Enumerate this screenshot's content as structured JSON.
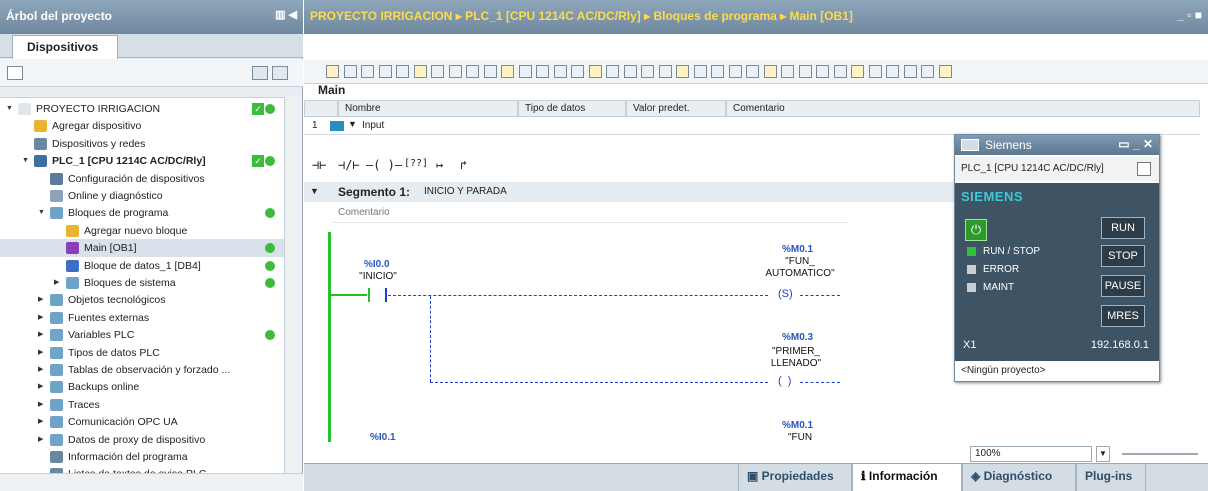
{
  "left_panel": {
    "title": "Árbol del proyecto",
    "tab": "Dispositivos",
    "tree": [
      {
        "label": "PROYECTO IRRIGACION",
        "indent": 0,
        "arrow": "▼",
        "icon": "project-icon",
        "color": "#e0e6ea",
        "check": true,
        "dot": true,
        "selected": false
      },
      {
        "label": "Agregar dispositivo",
        "indent": 1,
        "arrow": "",
        "icon": "add-device-icon",
        "color": "#e8b432",
        "check": false,
        "dot": false,
        "selected": false
      },
      {
        "label": "Dispositivos y redes",
        "indent": 1,
        "arrow": "",
        "icon": "network-icon",
        "color": "#6a86a0",
        "check": false,
        "dot": false,
        "selected": false
      },
      {
        "label": "PLC_1 [CPU 1214C AC/DC/Rly]",
        "indent": 1,
        "arrow": "▼",
        "icon": "plc-icon",
        "color": "#3f6fa0",
        "check": true,
        "dot": true,
        "selected": false,
        "bold": true
      },
      {
        "label": "Configuración de dispositivos",
        "indent": 2,
        "arrow": "",
        "icon": "config-icon",
        "color": "#5d7aa0",
        "check": false,
        "dot": false,
        "selected": false
      },
      {
        "label": "Online y diagnóstico",
        "indent": 2,
        "arrow": "",
        "icon": "diag-icon",
        "color": "#8aa3b8",
        "check": false,
        "dot": false,
        "selected": false
      },
      {
        "label": "Bloques de programa",
        "indent": 2,
        "arrow": "▼",
        "icon": "folder-icon",
        "color": "#6fa4c9",
        "check": false,
        "dot": true,
        "selected": false
      },
      {
        "label": "Agregar nuevo bloque",
        "indent": 3,
        "arrow": "",
        "icon": "add-block-icon",
        "color": "#e8b432",
        "check": false,
        "dot": false,
        "selected": false
      },
      {
        "label": "Main [OB1]",
        "indent": 3,
        "arrow": "",
        "icon": "ob-icon",
        "color": "#8a3fb8",
        "check": false,
        "dot": true,
        "selected": true
      },
      {
        "label": "Bloque de datos_1 [DB4]",
        "indent": 3,
        "arrow": "",
        "icon": "db-icon",
        "color": "#3d6fc9",
        "check": false,
        "dot": true,
        "selected": false
      },
      {
        "label": "Bloques de sistema",
        "indent": 3,
        "arrow": "▶",
        "icon": "folder-icon",
        "color": "#6fa4c9",
        "check": false,
        "dot": true,
        "selected": false
      },
      {
        "label": "Objetos tecnológicos",
        "indent": 2,
        "arrow": "▶",
        "icon": "tech-icon",
        "color": "#6fa4c9",
        "check": false,
        "dot": false,
        "selected": false
      },
      {
        "label": "Fuentes externas",
        "indent": 2,
        "arrow": "▶",
        "icon": "ext-icon",
        "color": "#6fa4c9",
        "check": false,
        "dot": false,
        "selected": false
      },
      {
        "label": "Variables PLC",
        "indent": 2,
        "arrow": "▶",
        "icon": "tags-icon",
        "color": "#6fa4c9",
        "check": false,
        "dot": true,
        "selected": false
      },
      {
        "label": "Tipos de datos PLC",
        "indent": 2,
        "arrow": "▶",
        "icon": "types-icon",
        "color": "#6fa4c9",
        "check": false,
        "dot": false,
        "selected": false
      },
      {
        "label": "Tablas de observación y forzado ...",
        "indent": 2,
        "arrow": "▶",
        "icon": "watch-icon",
        "color": "#6fa4c9",
        "check": false,
        "dot": false,
        "selected": false
      },
      {
        "label": "Backups online",
        "indent": 2,
        "arrow": "▶",
        "icon": "backup-icon",
        "color": "#6fa4c9",
        "check": false,
        "dot": false,
        "selected": false
      },
      {
        "label": "Traces",
        "indent": 2,
        "arrow": "▶",
        "icon": "trace-icon",
        "color": "#6fa4c9",
        "check": false,
        "dot": false,
        "selected": false
      },
      {
        "label": "Comunicación OPC UA",
        "indent": 2,
        "arrow": "▶",
        "icon": "opc-icon",
        "color": "#6fa4c9",
        "check": false,
        "dot": false,
        "selected": false
      },
      {
        "label": "Datos de proxy de dispositivo",
        "indent": 2,
        "arrow": "▶",
        "icon": "proxy-icon",
        "color": "#6fa4c9",
        "check": false,
        "dot": false,
        "selected": false
      },
      {
        "label": "Información del programa",
        "indent": 2,
        "arrow": "",
        "icon": "info-icon",
        "color": "#6a86a0",
        "check": false,
        "dot": false,
        "selected": false
      },
      {
        "label": "Listas de textos de aviso PLC",
        "indent": 2,
        "arrow": "",
        "icon": "list-icon",
        "color": "#6a86a0",
        "check": false,
        "dot": false,
        "selected": false
      }
    ]
  },
  "editor": {
    "breadcrumb": "PROYECTO IRRIGACION  ▸  PLC_1 [CPU 1214C AC/DC/Rly]  ▸  Bloques de programa  ▸  Main [OB1]",
    "block_name": "Main",
    "interface_headers": [
      "Nombre",
      "Tipo de datos",
      "Valor predet.",
      "Comentario"
    ],
    "interface_row_num": "1",
    "interface_row": "Input",
    "ladder_toolbar": [
      "⊣⊢",
      "⊣/⊢",
      "–( )–",
      "[??]",
      "↦",
      "↱"
    ],
    "segment_title": "Segmento 1:",
    "segment_subtitle": "INICIO Y PARADA",
    "comment_placeholder": "Comentario",
    "contact1_addr": "%I0.0",
    "contact1_name": "\"INICIO\"",
    "coil1_addr": "%M0.1",
    "coil1_name1": "\"FUN_",
    "coil1_name2": "AUTOMATICO\"",
    "coil1_symbol": "S",
    "coil2_addr": "%M0.3",
    "coil2_name1": "\"PRIMER_",
    "coil2_name2": "LLENADO\"",
    "contact2_addr": "%I0.1",
    "coil3_addr": "%M0.1",
    "coil3_name1": "\"FUN"
  },
  "plc_sim": {
    "title": "Siemens",
    "device": "PLC_1 [CPU 1214C AC/DC/Rly]",
    "brand": "SIEMENS",
    "buttons": [
      "RUN",
      "STOP",
      "PAUSE",
      "MRES"
    ],
    "leds": [
      {
        "label": "RUN / STOP",
        "color": "#33c03a"
      },
      {
        "label": "ERROR",
        "color": "#c9ced2"
      },
      {
        "label": "MAINT",
        "color": "#c9ced2"
      }
    ],
    "port": "X1",
    "ip": "192.168.0.1",
    "project": "<Ningún proyecto>"
  },
  "bottom": {
    "zoom": "100%",
    "tabs": [
      "Propiedades",
      "Información",
      "Diagnóstico",
      "Plug-ins"
    ]
  }
}
